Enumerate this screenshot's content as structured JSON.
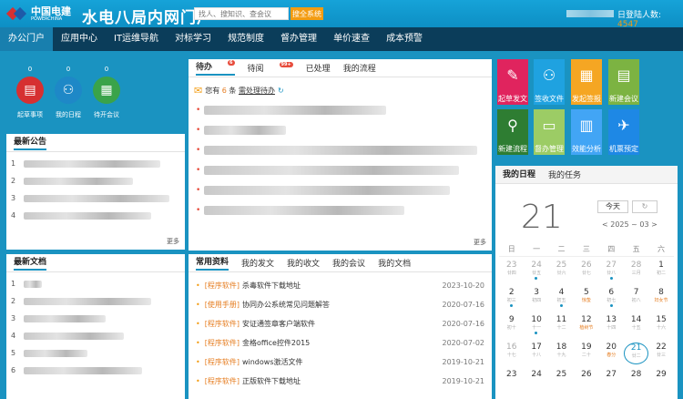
{
  "header": {
    "logo_cn": "中国电建",
    "logo_en": "POWERCHINA",
    "site_title": "水电八局内网门户",
    "search_placeholder": "找人、搜知识、查会议",
    "search_button": "搜全系统",
    "today_visits_label": "日登陆人数:",
    "today_visits_value": "4547"
  },
  "nav": [
    "办公门户",
    "应用中心",
    "IT运维导航",
    "对标学习",
    "规范制度",
    "督办管理",
    "单价速查",
    "成本预警"
  ],
  "quick_circles": [
    {
      "count": "0",
      "label": "起草事项",
      "color": "#d63031"
    },
    {
      "count": "0",
      "label": "我的日程",
      "color": "#1e88c7"
    },
    {
      "count": "0",
      "label": "待开会议",
      "color": "#3aa34a"
    }
  ],
  "notices": {
    "title": "最新公告",
    "more": "更多",
    "rows": [
      "1",
      "2",
      "3",
      "4"
    ]
  },
  "documents": {
    "title": "最新文档",
    "rows": [
      "1",
      "2",
      "3",
      "4",
      "5",
      "6"
    ]
  },
  "todo": {
    "tabs": [
      {
        "label": "待办",
        "badge": "6"
      },
      {
        "label": "待阅",
        "badge": "99+"
      },
      {
        "label": "已处理",
        "badge": ""
      },
      {
        "label": "我的流程",
        "badge": ""
      }
    ],
    "summary_prefix": "您有",
    "summary_count": "6",
    "summary_unit": "条",
    "summary_link": "需处理待办",
    "more": "更多"
  },
  "common_docs": {
    "tabs": [
      "常用资料",
      "我的发文",
      "我的收文",
      "我的会议",
      "我的文档"
    ],
    "items": [
      {
        "tag": "[程序软件]",
        "name": "杀毒软件下载地址",
        "date": "2023-10-20"
      },
      {
        "tag": "[使用手册]",
        "name": "协同办公系统常见问题解答",
        "date": "2020-07-16"
      },
      {
        "tag": "[程序软件]",
        "name": "安证通签章客户端软件",
        "date": "2020-07-16"
      },
      {
        "tag": "[程序软件]",
        "name": "金格office控件2015",
        "date": "2020-07-02"
      },
      {
        "tag": "[程序软件]",
        "name": "windows激活文件",
        "date": "2019-10-21"
      },
      {
        "tag": "[程序软件]",
        "name": "正版软件下载地址",
        "date": "2019-10-21"
      }
    ]
  },
  "tiles": [
    {
      "label": "起草发文",
      "color": "#e0245e",
      "icon": "📝"
    },
    {
      "label": "签收文件",
      "color": "#1fa2e0",
      "icon": "👥"
    },
    {
      "label": "发起签报",
      "color": "#f5a623",
      "icon": "📅"
    },
    {
      "label": "新建会议",
      "color": "#7cb342",
      "icon": "📋"
    },
    {
      "label": "新建流程",
      "color": "#2e7d32",
      "icon": "🔍"
    },
    {
      "label": "督办管理",
      "color": "#9ccc65",
      "icon": "📄"
    },
    {
      "label": "效能分析",
      "color": "#42a5f5",
      "icon": "📊"
    },
    {
      "label": "机票预定",
      "color": "#1e88e5",
      "icon": "✈"
    }
  ],
  "calendar": {
    "tabs": [
      "我的日程",
      "我的任务"
    ],
    "day": "21",
    "today_btn": "今天",
    "month_label": "< 2025 ~ 03 >",
    "weekdays": [
      "日",
      "一",
      "二",
      "三",
      "四",
      "五",
      "六"
    ],
    "weeks": [
      [
        {
          "d": "23",
          "l": "廿四",
          "g": true
        },
        {
          "d": "24",
          "l": "廿五",
          "g": true,
          "m": true
        },
        {
          "d": "25",
          "l": "廿六",
          "g": true
        },
        {
          "d": "26",
          "l": "廿七",
          "g": true
        },
        {
          "d": "27",
          "l": "廿八",
          "g": true,
          "m": true
        },
        {
          "d": "28",
          "l": "三月",
          "g": true
        },
        {
          "d": "1",
          "l": "初二"
        }
      ],
      [
        {
          "d": "2",
          "l": "初三",
          "m": true
        },
        {
          "d": "3",
          "l": "初四"
        },
        {
          "d": "4",
          "l": "初五",
          "m": true
        },
        {
          "d": "5",
          "l": "惊蛰"
        },
        {
          "d": "6",
          "l": "初七",
          "m": true
        },
        {
          "d": "7",
          "l": "初八"
        },
        {
          "d": "8",
          "l": "妇女节"
        }
      ],
      [
        {
          "d": "9",
          "l": "初十"
        },
        {
          "d": "10",
          "l": "十一",
          "m": true
        },
        {
          "d": "11",
          "l": "十二"
        },
        {
          "d": "12",
          "l": "植树节"
        },
        {
          "d": "13",
          "l": "十四"
        },
        {
          "d": "14",
          "l": "十五"
        },
        {
          "d": "15",
          "l": "十六"
        }
      ],
      [
        {
          "d": "16",
          "l": "十七",
          "g": true
        },
        {
          "d": "17",
          "l": "十八"
        },
        {
          "d": "18",
          "l": "十九"
        },
        {
          "d": "19",
          "l": "二十"
        },
        {
          "d": "20",
          "l": "春分"
        },
        {
          "d": "21",
          "l": "廿二",
          "today": true
        },
        {
          "d": "22",
          "l": "廿三"
        }
      ],
      [
        {
          "d": "23",
          "l": ""
        },
        {
          "d": "24",
          "l": ""
        },
        {
          "d": "25",
          "l": ""
        },
        {
          "d": "26",
          "l": ""
        },
        {
          "d": "27",
          "l": ""
        },
        {
          "d": "28",
          "l": ""
        },
        {
          "d": "29",
          "l": ""
        }
      ]
    ]
  }
}
